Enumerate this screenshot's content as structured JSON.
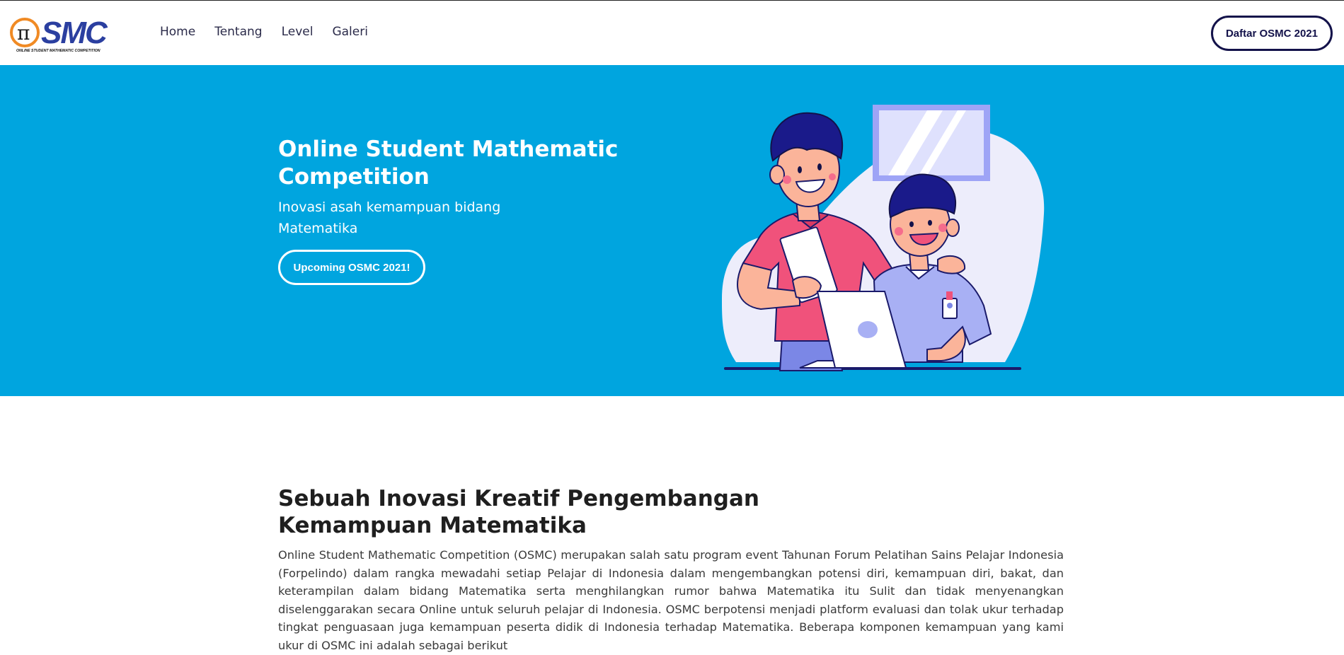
{
  "nav": {
    "logo_text": "SMC",
    "logo_tagline": "ONLINE STUDENT MATHEMATIC COMPETITION",
    "links": [
      "Home",
      "Tentang",
      "Level",
      "Galeri"
    ],
    "cta_label": "Daftar OSMC 2021"
  },
  "hero": {
    "title": "Online Student Mathematic Competition",
    "subtitle": "Inovasi asah kemampuan bidang Matematika",
    "button_label": "Upcoming OSMC 2021!"
  },
  "about": {
    "title": "Sebuah Inovasi Kreatif Pengembangan Kemampuan Matematika",
    "text": "Online Student Mathematic Competition (OSMC) merupakan salah satu program event Tahunan Forum Pelatihan Sains Pelajar Indonesia (Forpelindo) dalam rangka mewadahi setiap Pelajar di Indonesia dalam mengembangkan potensi diri, kemampuan diri, bakat, dan keterampilan dalam bidang Matematika serta menghilangkan rumor bahwa Matematika itu Sulit dan tidak menyenangkan diselenggarakan secara Online untuk seluruh pelajar di Indonesia. OSMC berpotensi menjadi platform evaluasi dan tolak ukur terhadap tingkat penguasaan juga kemampuan peserta didik di Indonesia terhadap Matematika. Beberapa komponen kemampuan yang kami ukur di OSMC ini adalah sebagai berikut"
  },
  "colors": {
    "hero_bg": "#00a5df",
    "navy": "#13124a",
    "logo_orange": "#f08a24",
    "logo_blue": "#2b3fa0"
  },
  "icons": {
    "logo": "pi-logo-icon",
    "illustration": "students-laptop-illustration"
  }
}
